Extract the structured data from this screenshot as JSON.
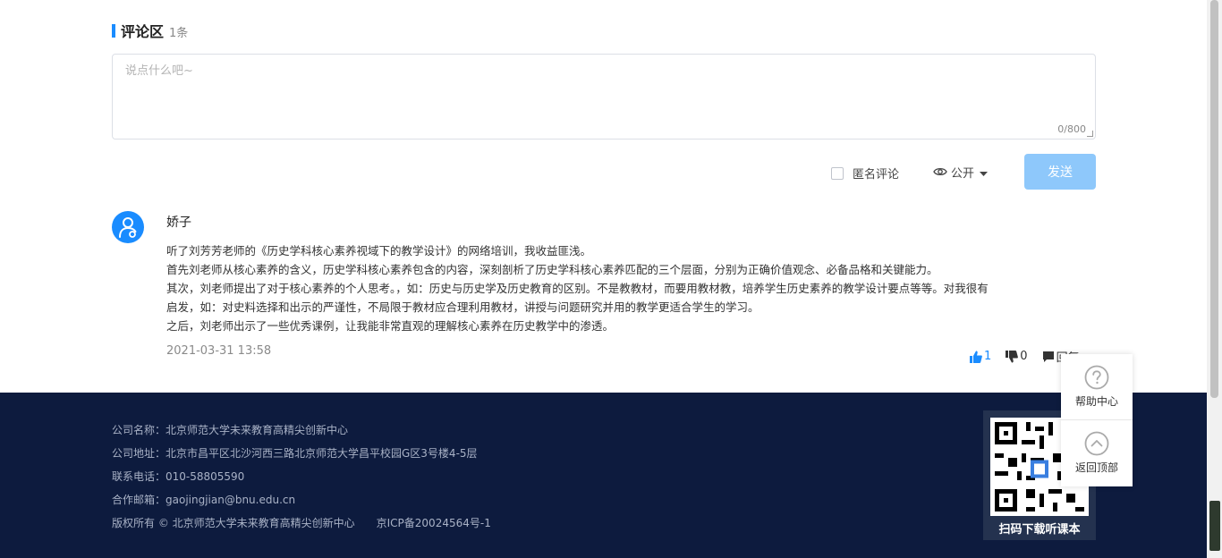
{
  "comments_section": {
    "title": "评论区",
    "count": "1条",
    "input_placeholder": "说点什么吧~",
    "char_counter": "0/800",
    "anonymous_label": "匿名评论",
    "visibility_label": "公开",
    "send_label": "发送"
  },
  "comment": {
    "author": "娇子",
    "lines": [
      "听了刘芳芳老师的《历史学科核心素养视域下的教学设计》的网络培训，我收益匪浅。",
      "首先刘老师从核心素养的含义，历史学科核心素养包含的内容，深刻剖析了历史学科核心素养匹配的三个层面，分别为正确价值观念、必备品格和关键能力。",
      "其次，刘老师提出了对于核心素养的个人思考。，如：历史与历史学及历史教育的区别。不是教教材，而要用教材教，培养学生历史素养的教学设计要点等等。对我很有",
      "启发，如：对史料选择和出示的严谨性，不局限于教材应合理利用教材，讲授与问题研究并用的教学更适合学生的学习。",
      "之后，刘老师出示了一些优秀课例，让我能非常直观的理解核心素养在历史教学中的渗透。"
    ],
    "date": "2021-03-31 13:58",
    "likes": "1",
    "dislikes": "0",
    "reply_label": "回复"
  },
  "footer": {
    "company_name": "公司名称：北京师范大学未来教育高精尖创新中心",
    "address": "公司地址：北京市昌平区北沙河西三路北京师范大学昌平校园G区3号楼4-5层",
    "phone": "联系电话：010-58805590",
    "email": "合作邮箱：gaojingjian@bnu.edu.cn",
    "copyright": "版权所有 © 北京师范大学未来教育高精尖创新中心　　京ICP备20024564号-1",
    "qr_label": "扫码下载听课本"
  },
  "side_panel": {
    "help_label": "帮助中心",
    "top_label": "返回顶部"
  },
  "colors": {
    "accent": "#1a8cff",
    "send_disabled": "#8ec8fb",
    "footer_bg": "#0d1b3e"
  }
}
